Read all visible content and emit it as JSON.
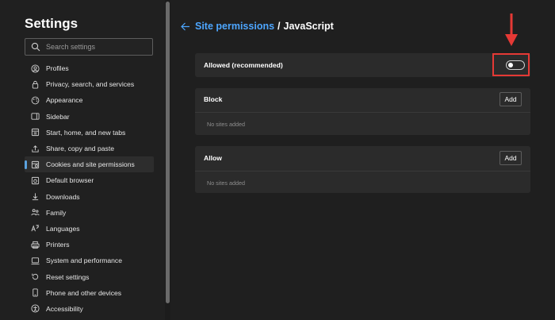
{
  "sidebar": {
    "title": "Settings",
    "search": {
      "placeholder": "Search settings",
      "value": ""
    },
    "items": [
      {
        "label": "Profiles",
        "icon": "profile-icon"
      },
      {
        "label": "Privacy, search, and services",
        "icon": "lock-icon"
      },
      {
        "label": "Appearance",
        "icon": "appearance-icon"
      },
      {
        "label": "Sidebar",
        "icon": "sidebar-icon"
      },
      {
        "label": "Start, home, and new tabs",
        "icon": "home-tabs-icon"
      },
      {
        "label": "Share, copy and paste",
        "icon": "share-icon"
      },
      {
        "label": "Cookies and site permissions",
        "icon": "cookies-icon",
        "active": true
      },
      {
        "label": "Default browser",
        "icon": "browser-icon"
      },
      {
        "label": "Downloads",
        "icon": "download-icon"
      },
      {
        "label": "Family",
        "icon": "family-icon"
      },
      {
        "label": "Languages",
        "icon": "languages-icon"
      },
      {
        "label": "Printers",
        "icon": "printer-icon"
      },
      {
        "label": "System and performance",
        "icon": "system-icon"
      },
      {
        "label": "Reset settings",
        "icon": "reset-icon"
      },
      {
        "label": "Phone and other devices",
        "icon": "phone-icon"
      },
      {
        "label": "Accessibility",
        "icon": "accessibility-icon"
      }
    ]
  },
  "main": {
    "breadcrumb": {
      "parent": "Site permissions",
      "separator": "/",
      "current": "JavaScript"
    },
    "allowed": {
      "label": "Allowed (recommended)",
      "toggle_on": false
    },
    "block": {
      "title": "Block",
      "add_label": "Add",
      "empty": "No sites added"
    },
    "allow": {
      "title": "Allow",
      "add_label": "Add",
      "empty": "No sites added"
    }
  },
  "colors": {
    "accent": "#4da6ff",
    "annotation": "#e53935",
    "background": "#1f1f1f",
    "card": "#2b2b2b"
  }
}
